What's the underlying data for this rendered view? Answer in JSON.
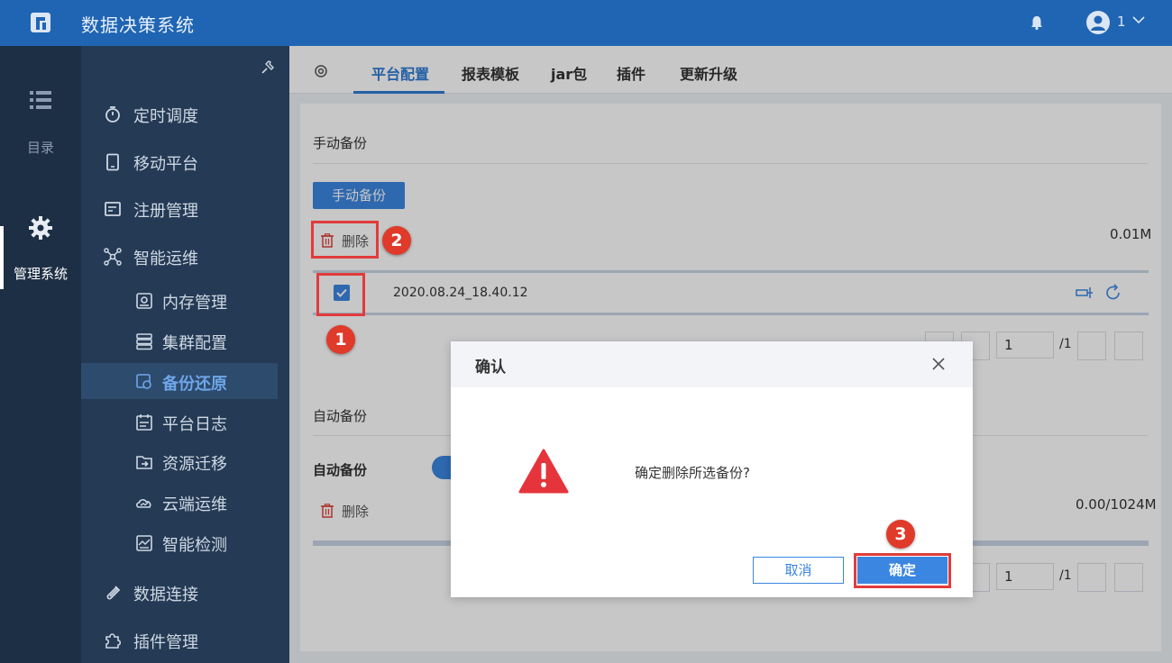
{
  "colors": {
    "topbar": "#1f65b3",
    "rail": "#1d2f45",
    "sidebar": "#243a55",
    "accent": "#3b86e0",
    "highlight": "#e23b3b",
    "warning": "#e5343b"
  },
  "header": {
    "app_title": "数据决策系统",
    "user_name": "1",
    "icons": [
      "logo-icon",
      "bell-icon",
      "avatar-icon",
      "chevron-down-icon"
    ]
  },
  "rail": {
    "items": [
      {
        "label": "目录",
        "icon": "list-icon"
      },
      {
        "label": "管理系统",
        "icon": "gear-icon",
        "active": true
      }
    ]
  },
  "sidebar": {
    "items": [
      {
        "label": "定时调度",
        "icon": "stopwatch-icon"
      },
      {
        "label": "移动平台",
        "icon": "mobile-icon"
      },
      {
        "label": "注册管理",
        "icon": "register-icon"
      },
      {
        "label": "智能运维",
        "icon": "network-icon"
      },
      {
        "label": "内存管理",
        "icon": "memory-icon"
      },
      {
        "label": "集群配置",
        "icon": "server-stack-icon"
      },
      {
        "label": "备份还原",
        "icon": "backup-icon",
        "selected": true
      },
      {
        "label": "平台日志",
        "icon": "log-icon"
      },
      {
        "label": "资源迁移",
        "icon": "migrate-icon"
      },
      {
        "label": "云端运维",
        "icon": "cloud-ops-icon"
      },
      {
        "label": "智能检测",
        "icon": "monitor-icon"
      },
      {
        "label": "数据连接",
        "icon": "link-icon"
      },
      {
        "label": "插件管理",
        "icon": "puzzle-icon"
      }
    ]
  },
  "tabs": [
    {
      "label": "平台配置",
      "active": true
    },
    {
      "label": "报表模板"
    },
    {
      "label": "jar包"
    },
    {
      "label": "插件"
    },
    {
      "label": "更新升级"
    }
  ],
  "manual_backup": {
    "title": "手动备份",
    "button_label": "手动备份",
    "delete_label": "删除",
    "size": "0.01M",
    "rows": [
      {
        "name": "2020.08.24_18.40.12",
        "checked": true
      }
    ],
    "page": "1",
    "total_pages": "/1"
  },
  "auto_backup": {
    "title": "自动备份",
    "toggle_label": "自动备份",
    "delete_label": "删除",
    "size": "0.00/1024M",
    "page": "1",
    "total_pages": "/1"
  },
  "dialog": {
    "title": "确认",
    "message": "确定删除所选备份?",
    "cancel_label": "取消",
    "ok_label": "确定"
  },
  "annotations": {
    "steps": [
      "1",
      "2",
      "3"
    ]
  }
}
